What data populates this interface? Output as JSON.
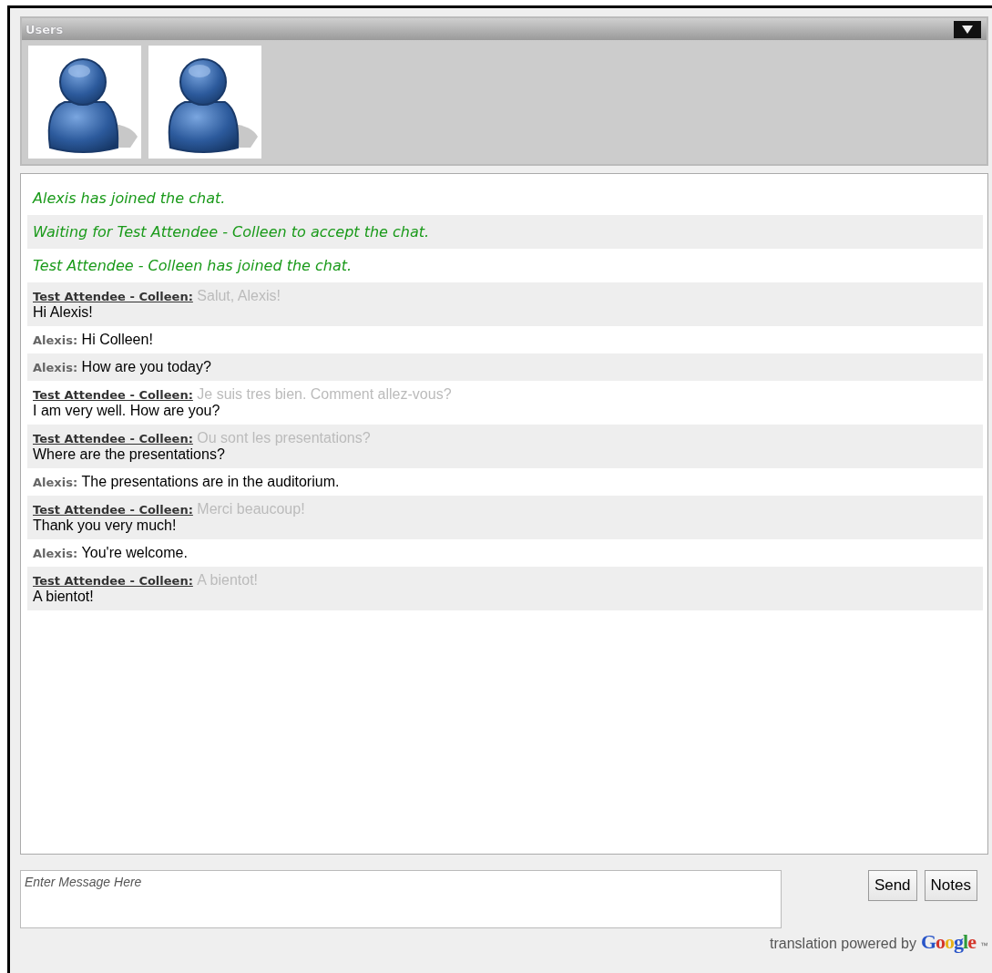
{
  "users_panel": {
    "title": "Users"
  },
  "messages": [
    {
      "kind": "system",
      "text": "Alexis has joined the chat."
    },
    {
      "kind": "system",
      "text": "Waiting for Test Attendee - Colleen to accept the chat."
    },
    {
      "kind": "system",
      "text": "Test Attendee - Colleen has joined the chat."
    },
    {
      "kind": "remote",
      "sender": "Test Attendee - Colleen:",
      "original": "Salut, Alexis!",
      "text": "Hi Alexis!"
    },
    {
      "kind": "local",
      "sender": "Alexis:",
      "text": "Hi Colleen!"
    },
    {
      "kind": "local",
      "sender": "Alexis:",
      "text": "How are you today?"
    },
    {
      "kind": "remote",
      "sender": "Test Attendee - Colleen:",
      "original": "Je suis tres bien. Comment allez-vous?",
      "text": "I am very well. How are you?"
    },
    {
      "kind": "remote",
      "sender": "Test Attendee - Colleen:",
      "original": "Ou sont les presentations?",
      "text": "Where are the presentations?"
    },
    {
      "kind": "local",
      "sender": "Alexis:",
      "text": "The presentations are in the auditorium."
    },
    {
      "kind": "remote",
      "sender": "Test Attendee - Colleen:",
      "original": "Merci beaucoup!",
      "text": "Thank you very much!"
    },
    {
      "kind": "local",
      "sender": "Alexis:",
      "text": "You're welcome."
    },
    {
      "kind": "remote",
      "sender": "Test Attendee - Colleen:",
      "original": "A bientot!",
      "text": "A bientot!"
    }
  ],
  "composer": {
    "placeholder": "Enter Message Here",
    "buttons": [
      "Send",
      "Notes"
    ]
  },
  "footer": {
    "text": "translation powered by",
    "logo": "Google",
    "trademark": "™"
  }
}
